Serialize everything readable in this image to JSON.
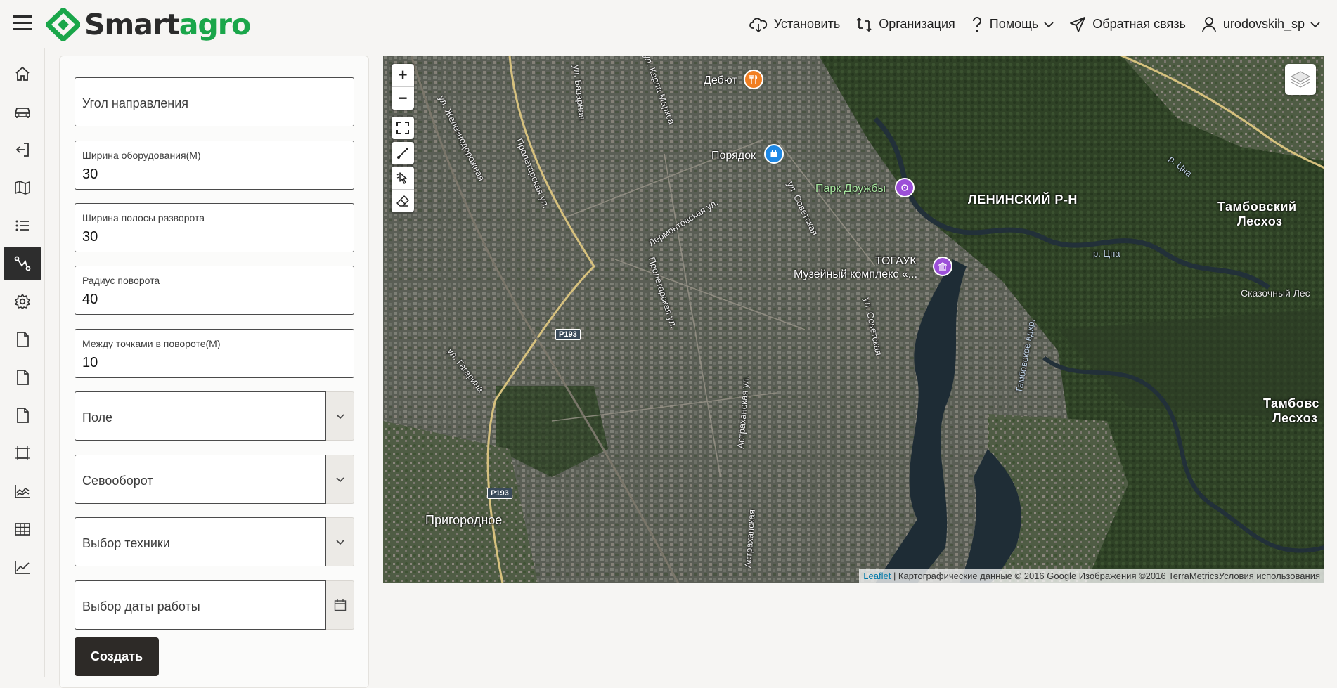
{
  "header": {
    "logo_part1": "Smart",
    "logo_part2": "agro",
    "nav": {
      "install": "Установить",
      "organization": "Организация",
      "help": "Помощь",
      "feedback": "Обратная связь",
      "user": "urodovskih_sp"
    }
  },
  "sidebar": {
    "items": [
      {
        "icon": "home-icon"
      },
      {
        "icon": "car-icon"
      },
      {
        "icon": "logout-arrow-icon"
      },
      {
        "icon": "map-icon"
      },
      {
        "icon": "list-icon"
      },
      {
        "icon": "route-icon",
        "active": true
      },
      {
        "icon": "gear-icon"
      },
      {
        "icon": "document-icon"
      },
      {
        "icon": "document-icon"
      },
      {
        "icon": "document-icon"
      },
      {
        "icon": "frame-icon"
      },
      {
        "icon": "area-chart-icon"
      },
      {
        "icon": "grid-table-icon"
      },
      {
        "icon": "line-chart-icon"
      }
    ]
  },
  "form": {
    "direction_angle": {
      "placeholder": "Угол направления"
    },
    "equipment_width": {
      "label": "Ширина оборудования(М)",
      "value": "30"
    },
    "turn_strip_width": {
      "label": "Ширина полосы разворота",
      "value": "30"
    },
    "turn_radius": {
      "label": "Радиус поворота",
      "value": "40"
    },
    "turn_points": {
      "label": "Между точками в повороте(М)",
      "value": "10"
    },
    "field_select": {
      "placeholder": "Поле"
    },
    "rotation_select": {
      "placeholder": "Севооборот"
    },
    "machine_select": {
      "placeholder": "Выбор техники"
    },
    "date_select": {
      "placeholder": "Выбор даты работы"
    },
    "create_label": "Создать"
  },
  "map": {
    "zoom_in": "+",
    "zoom_out": "−",
    "attribution_link": "Leaflet",
    "attribution_text": " | Картографические данные © 2016 Google Изображения ©2016 TerraMetricsУсловия использования",
    "labels": {
      "debut": "Дебют",
      "poryadok": "Порядок",
      "park": "Парк Дружбы",
      "leninsky": "ЛЕНИНСКИЙ Р-Н",
      "tambov_forest1": "Тамбовский",
      "tambov_forest1b": "Лесхоз",
      "togauk": "ТОГАУК",
      "museum": "Музейный комплекс «...",
      "skazochny": "Сказочный Лес",
      "tsna_river": "р. Цна",
      "tsna_river2": "р. Цна",
      "tambov_forest2": "Тамбовс",
      "tambov_forest2b": "Лесхоз",
      "prigorodnoe": "Пригородное",
      "reservoir": "Тамбовское вдхр.",
      "road1": "Р193",
      "road2": "Р193",
      "st_proletarskaya": "Пролетарская ул.",
      "st_proletarskaya2": "Пролетарская ул.",
      "st_lermontovskaya": "Лермонтовская ул.",
      "st_sovetskaya": "ул. Советская",
      "st_sovetskaya2": "ул. Советская",
      "st_astrakhanskaya": "Астраханская ул.",
      "st_astrakhanskaya2": "Астраханская",
      "st_gagarina": "ул. Гагарина",
      "st_zheleznodorozhnaya": "ул. Железнодорожная",
      "st_bazarnaya": "ул. Базарная",
      "st_karla_marksa": "ул. Карла Маркса"
    }
  }
}
